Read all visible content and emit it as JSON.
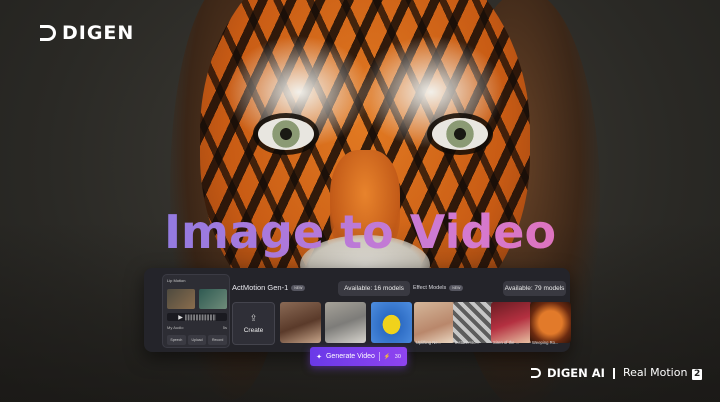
{
  "logo": {
    "text": "DIGEN"
  },
  "headline": "Image to Video",
  "lip_motion": {
    "title": "Lip Motion",
    "audio_name": "My Audio",
    "duration": "5s",
    "buttons": [
      "Speech",
      "Upload",
      "Record"
    ]
  },
  "actmotion": {
    "title": "ActMotion Gen-1",
    "badge": "NEW",
    "available": "Available: 16 models",
    "create_label": "Create"
  },
  "effect_models": {
    "title": "Effect Models",
    "badge": "NEW",
    "available": "Available: 79 models",
    "cards": [
      "Uplifting Ne...",
      "Instant Asc...",
      "Siren of the ...",
      "Weeping Ro..."
    ]
  },
  "generate": {
    "label": "Generate Video",
    "cost": "30"
  },
  "brand": {
    "name": "DIGEN AI",
    "product": "Real Motion",
    "version": "2"
  },
  "colors": {
    "headline_start": "#6f7ee6",
    "headline_end": "#f0669b",
    "button": "#7a3ff0"
  }
}
